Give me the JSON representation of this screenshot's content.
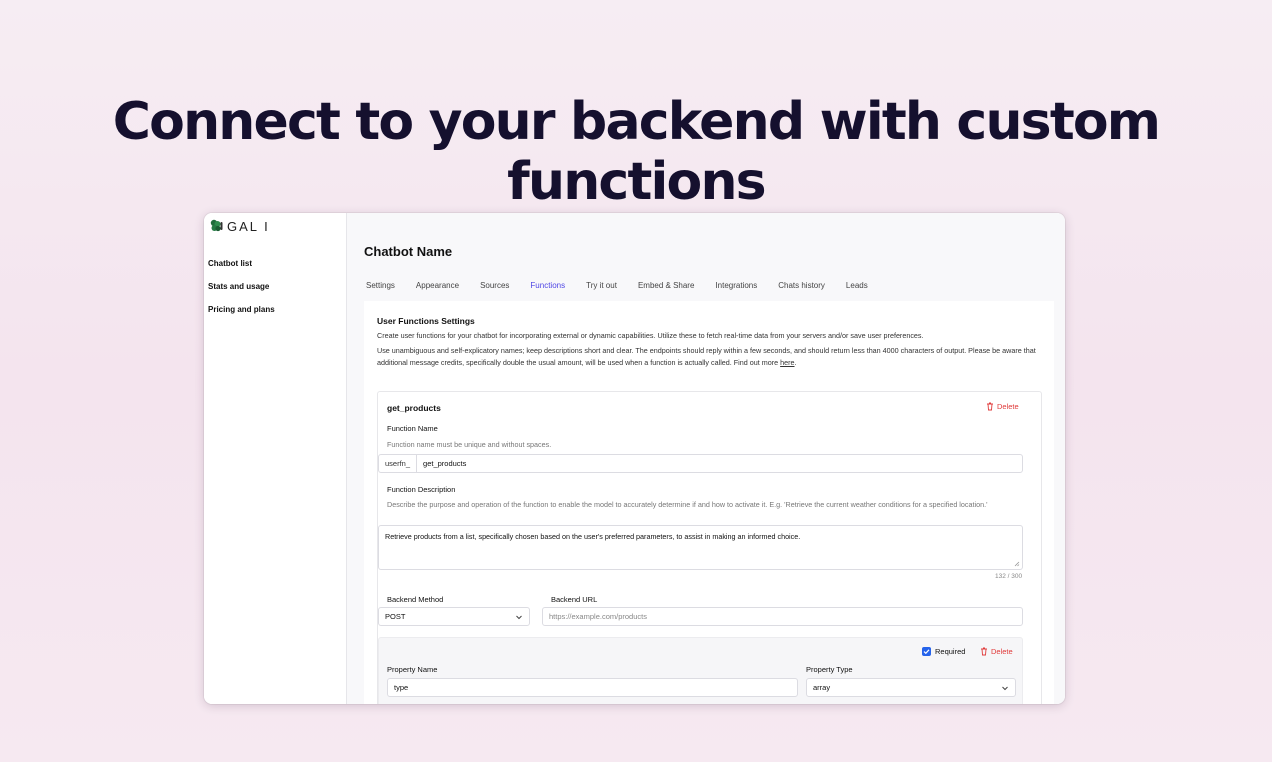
{
  "hero": {
    "title": "Connect to your backend with custom functions"
  },
  "sidebar": {
    "logo_text": "GAL I",
    "items": [
      {
        "label": "Chatbot list"
      },
      {
        "label": "Stats and usage"
      },
      {
        "label": "Pricing and plans"
      }
    ]
  },
  "header": {
    "title": "Chatbot Name"
  },
  "tabs": [
    {
      "label": "Settings"
    },
    {
      "label": "Appearance"
    },
    {
      "label": "Sources"
    },
    {
      "label": "Functions",
      "active": true
    },
    {
      "label": "Try it out"
    },
    {
      "label": "Embed & Share"
    },
    {
      "label": "Integrations"
    },
    {
      "label": "Chats history"
    },
    {
      "label": "Leads"
    }
  ],
  "section": {
    "title": "User Functions Settings",
    "description1": "Create user functions for your chatbot for incorporating external or dynamic capabilities. Utilize these to fetch real-time data from your servers and/or save user preferences.",
    "description2_part1": "Use unambiguous and self-explicatory names; keep descriptions short and clear. The endpoints should reply within a few seconds, and should return less than 4000 characters of output. Please be aware that additional message credits, specifically double the usual amount, will be used when a function is actually called. Find out more ",
    "description2_link": "here",
    "description2_part2": "."
  },
  "function_card": {
    "title": "get_products",
    "delete_label": "Delete",
    "name_label": "Function Name",
    "name_hint": "Function name must be unique and without spaces.",
    "name_prefix": "userfn_",
    "name_value": "get_products",
    "description_label": "Function Description",
    "description_hint": "Describe the purpose and operation of the function to enable the model to accurately determine if and how to activate it. E.g. 'Retrieve the current weather conditions for a specified location.'",
    "description_value": "Retrieve products from a list, specifically chosen based on the user's preferred parameters, to assist in making an informed choice.",
    "description_counter": "132 / 300",
    "method_label": "Backend Method",
    "method_value": "POST",
    "url_label": "Backend URL",
    "url_placeholder": "https://example.com/products",
    "property": {
      "required_label": "Required",
      "required_checked": true,
      "delete_label": "Delete",
      "name_label": "Property Name",
      "name_value": "type",
      "type_label": "Property Type",
      "type_value": "array"
    }
  },
  "colors": {
    "accent": "#4f46e5",
    "danger": "#e03a3a",
    "checkbox": "#2563eb",
    "hero_text": "#15102e"
  }
}
